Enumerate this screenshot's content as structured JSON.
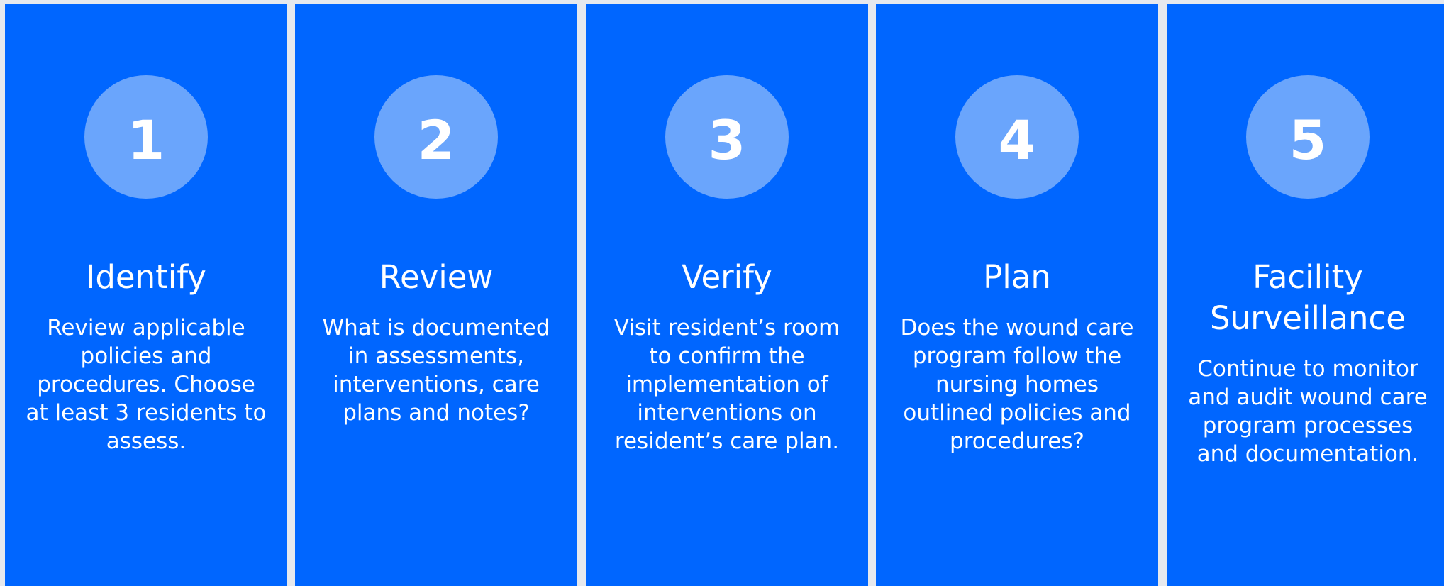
{
  "colors": {
    "background": "#e6e9ee",
    "panel": "#0066ff",
    "circle": "#6aa5fc",
    "text": "#ffffff"
  },
  "steps": [
    {
      "number": "1",
      "title_lines": [
        "Identify"
      ],
      "description_lines": [
        "Review applicable",
        "policies and",
        "procedures. Choose",
        "at least 3 residents to",
        "assess."
      ]
    },
    {
      "number": "2",
      "title_lines": [
        "Review"
      ],
      "description_lines": [
        "What is documented",
        "in assessments,",
        "interventions, care",
        "plans and notes?"
      ]
    },
    {
      "number": "3",
      "title_lines": [
        "Verify"
      ],
      "description_lines": [
        "Visit resident’s room",
        "to confirm the",
        "implementation of",
        "interventions on",
        "resident’s care plan."
      ]
    },
    {
      "number": "4",
      "title_lines": [
        "Plan"
      ],
      "description_lines": [
        "Does the wound care",
        "program follow the",
        "nursing homes",
        "outlined policies and",
        "procedures?"
      ]
    },
    {
      "number": "5",
      "title_lines": [
        "Facility",
        "Surveillance"
      ],
      "description_lines": [
        "Continue to monitor",
        "and audit wound care",
        "program processes",
        "and documentation."
      ]
    }
  ]
}
